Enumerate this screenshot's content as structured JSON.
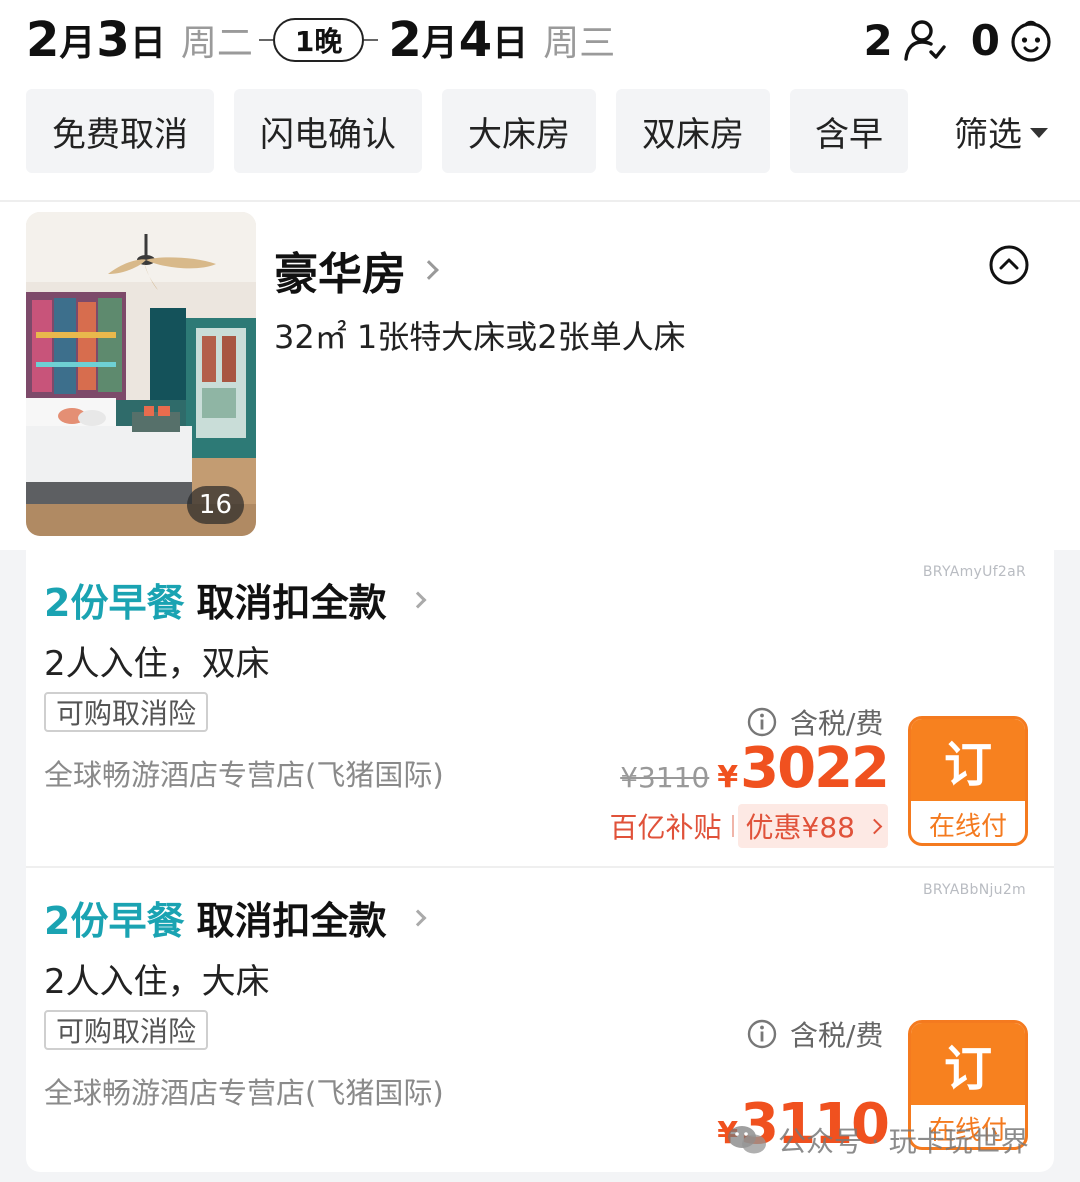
{
  "header": {
    "checkin": {
      "month": "2",
      "month_unit": "月",
      "day": "3",
      "day_unit": "日",
      "weekday": "周二"
    },
    "nights": "1晚",
    "checkout": {
      "month": "2",
      "month_unit": "月",
      "day": "4",
      "day_unit": "日",
      "weekday": "周三"
    },
    "adults": "2",
    "children": "0",
    "icons": {
      "adult": "person-icon",
      "child": "baby-face-icon"
    }
  },
  "filters": {
    "chips": [
      "免费取消",
      "闪电确认",
      "大床房",
      "双床房",
      "含早"
    ],
    "filter_label": "筛选"
  },
  "room": {
    "title": "豪华房",
    "spec": "32㎡  1张特大床或2张单人床",
    "photo_count": "16"
  },
  "offers": [
    {
      "code": "BRYAmyUf2aR",
      "breakfast": "2份早餐",
      "cancel": "取消扣全款",
      "occupancy": "2人入住，双床",
      "insurance": "可购取消险",
      "seller": "全球畅游酒店专营店(飞猪国际)",
      "tax": "含税/费",
      "old_price": "¥3110",
      "currency": "¥",
      "price": "3022",
      "subsidy_a": "百亿补贴",
      "subsidy_b": "优惠¥88",
      "book": "订",
      "pay": "在线付"
    },
    {
      "code": "BRYABbNju2m",
      "breakfast": "2份早餐",
      "cancel": "取消扣全款",
      "occupancy": "2人入住，大床",
      "insurance": "可购取消险",
      "seller": "全球畅游酒店专营店(飞猪国际)",
      "tax": "含税/费",
      "currency": "¥",
      "price": "3110",
      "book": "订",
      "pay": "在线付"
    }
  ],
  "watermark": "公众号 · 玩卡玩世界",
  "colors": {
    "accent_teal": "#1aa3b2",
    "price_red": "#f0511f",
    "book_orange": "#f7811f"
  }
}
